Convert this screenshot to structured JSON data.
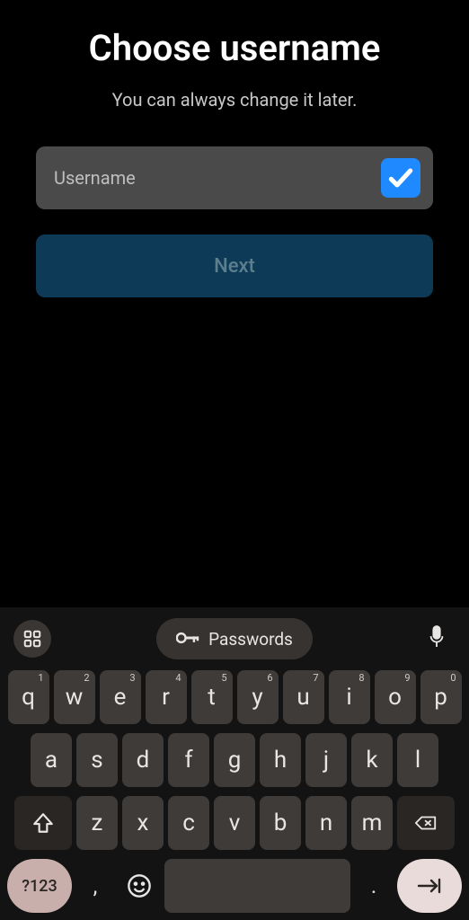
{
  "header": {
    "title": "Choose username",
    "subtitle": "You can always change it later."
  },
  "form": {
    "username_placeholder": "Username",
    "username_value": "",
    "next_label": "Next"
  },
  "keyboard": {
    "passwords_label": "Passwords",
    "row1": [
      {
        "k": "q",
        "s": "1"
      },
      {
        "k": "w",
        "s": "2"
      },
      {
        "k": "e",
        "s": "3"
      },
      {
        "k": "r",
        "s": "4"
      },
      {
        "k": "t",
        "s": "5"
      },
      {
        "k": "y",
        "s": "6"
      },
      {
        "k": "u",
        "s": "7"
      },
      {
        "k": "i",
        "s": "8"
      },
      {
        "k": "o",
        "s": "9"
      },
      {
        "k": "p",
        "s": "0"
      }
    ],
    "row2": [
      {
        "k": "a"
      },
      {
        "k": "s"
      },
      {
        "k": "d"
      },
      {
        "k": "f"
      },
      {
        "k": "g"
      },
      {
        "k": "h"
      },
      {
        "k": "j"
      },
      {
        "k": "k"
      },
      {
        "k": "l"
      }
    ],
    "row3": [
      {
        "k": "z"
      },
      {
        "k": "x"
      },
      {
        "k": "c"
      },
      {
        "k": "v"
      },
      {
        "k": "b"
      },
      {
        "k": "n"
      },
      {
        "k": "m"
      }
    ],
    "symbols_label": "?123",
    "comma": ",",
    "period": "."
  }
}
